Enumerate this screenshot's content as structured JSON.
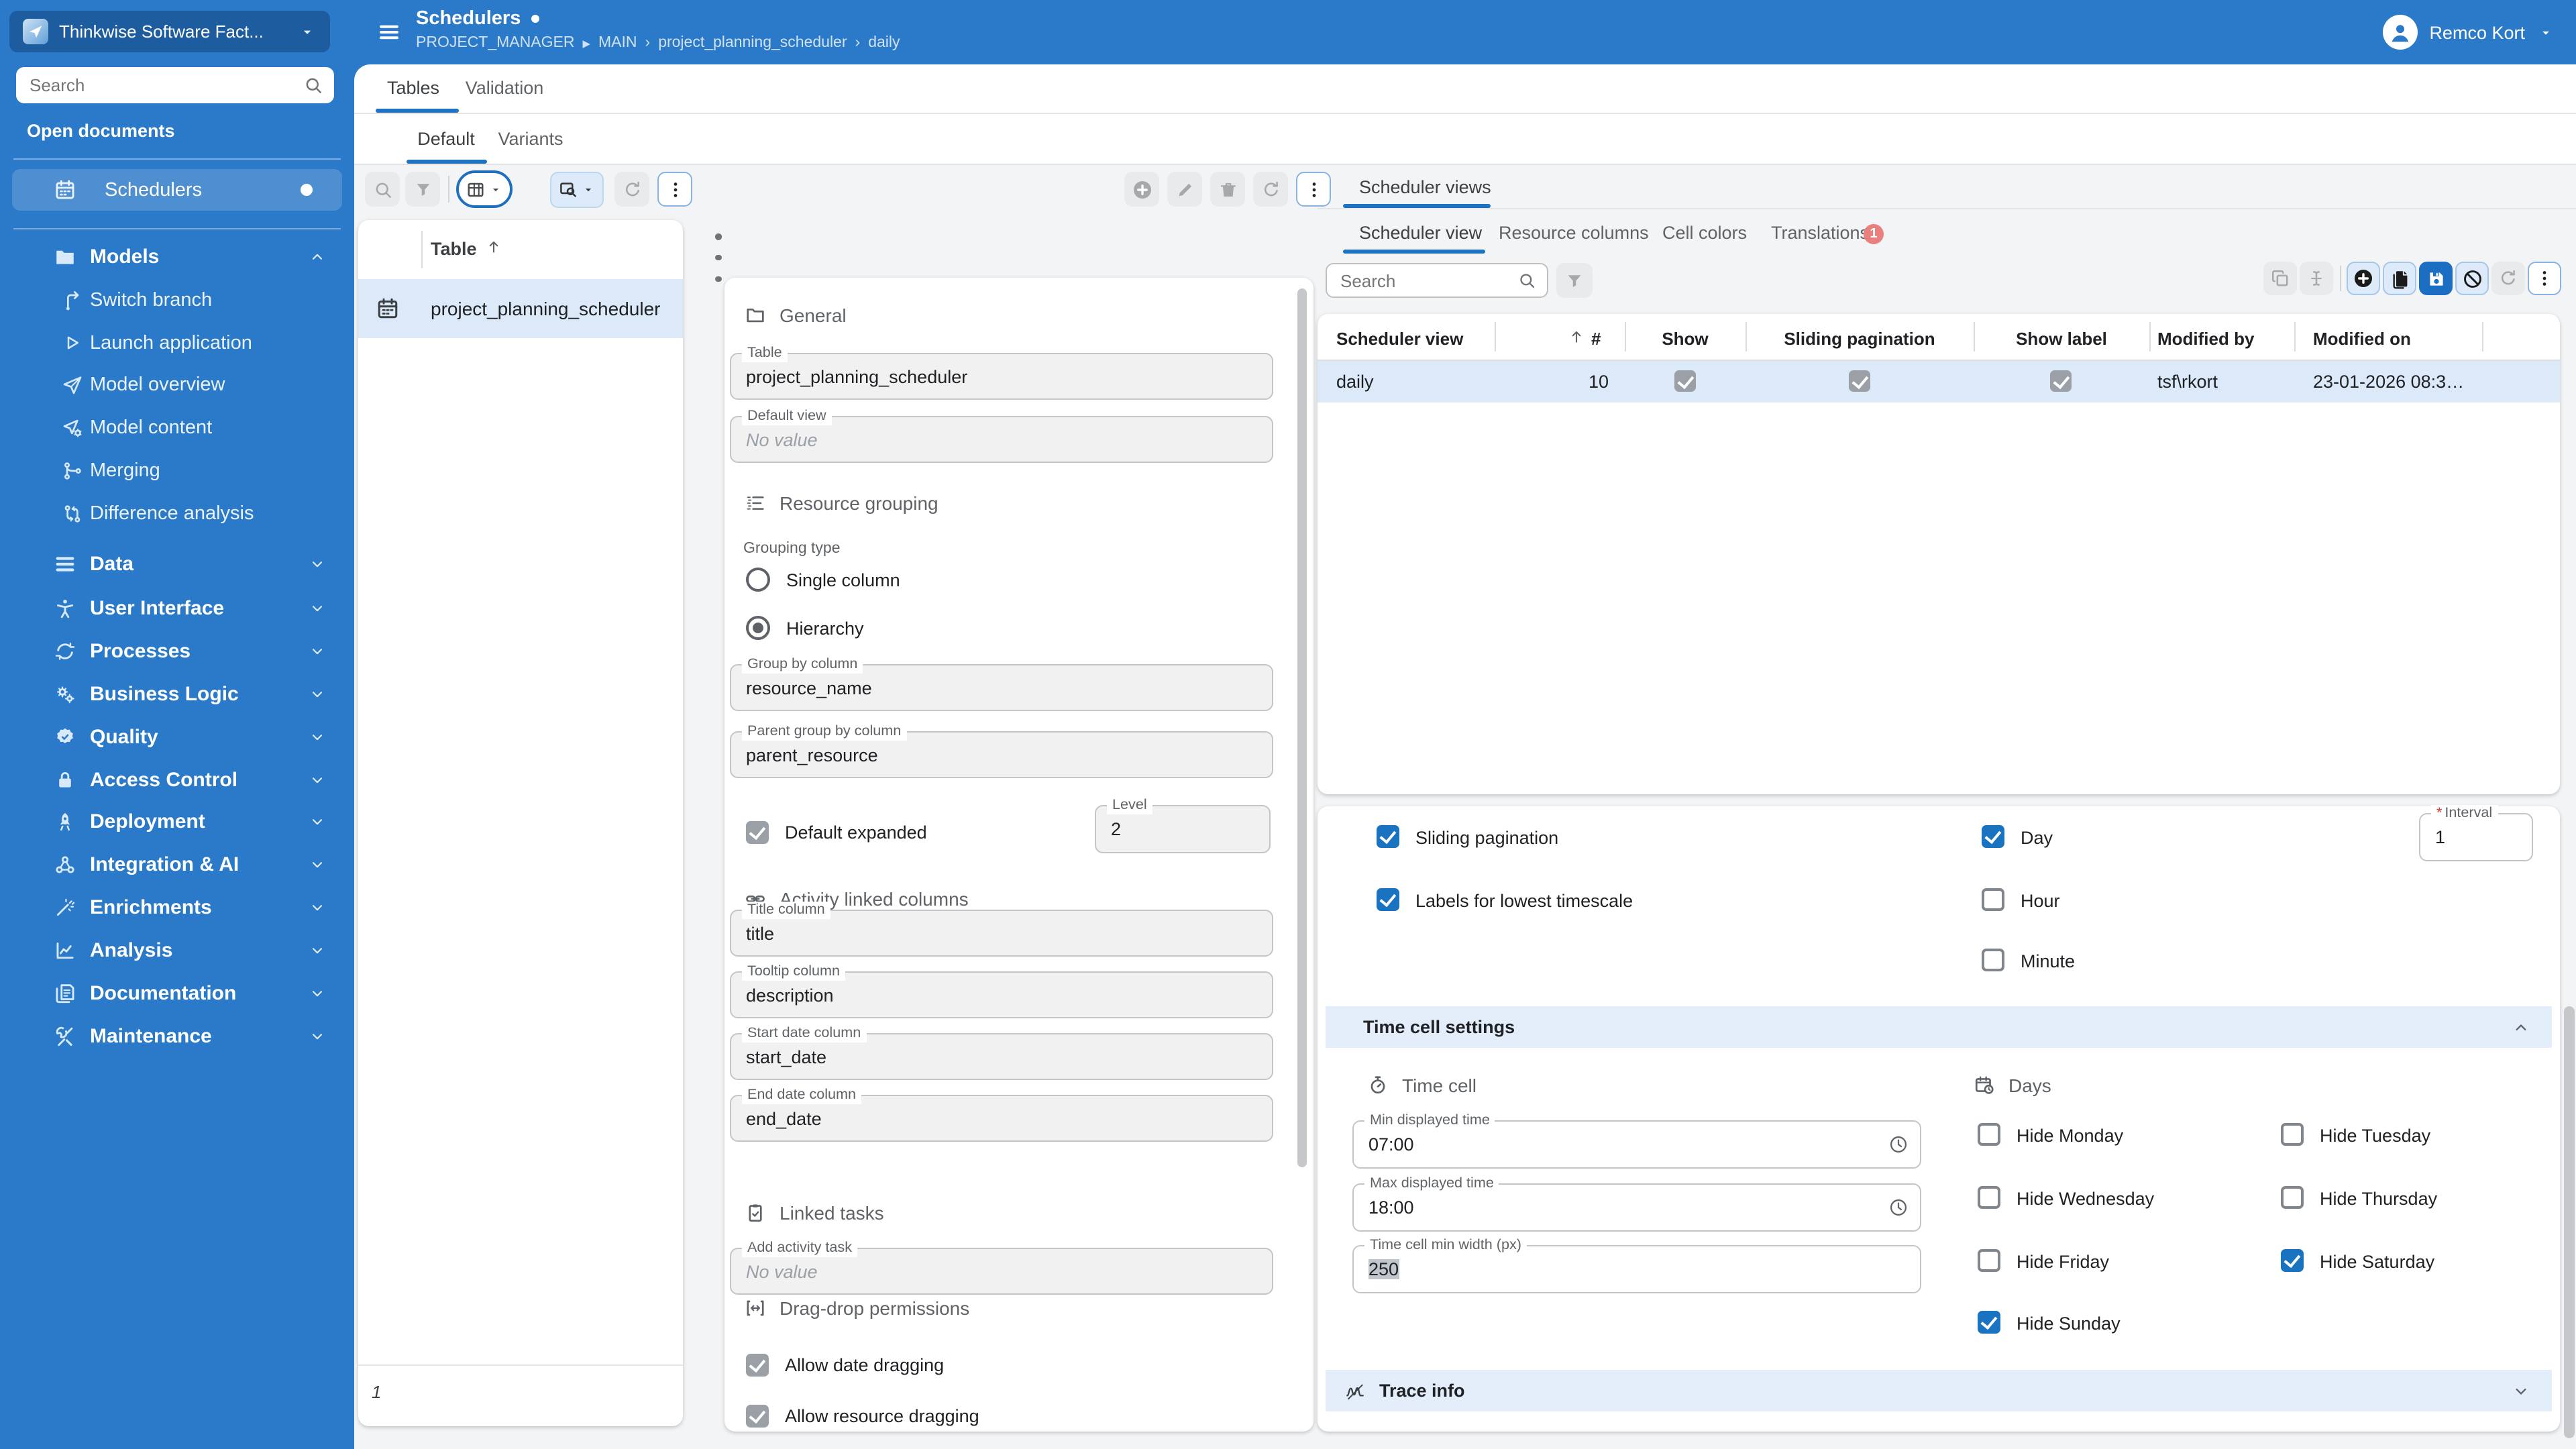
{
  "app": {
    "accent": "#1e72c2",
    "header_blue": "#2b7ac9",
    "selection_blue": "#dbe9f8",
    "badge_red": "#e9807e",
    "save_blue": "#1b6ec2"
  },
  "header": {
    "workspace_selector": "Thinkwise Software Fact...",
    "page_title": "Schedulers",
    "breadcrumb": {
      "items": [
        "PROJECT_MANAGER",
        "MAIN",
        "project_planning_scheduler",
        "daily"
      ],
      "separators": [
        "▸",
        "›",
        "›"
      ]
    },
    "user_name": "Remco Kort"
  },
  "sidebar": {
    "search_placeholder": "Search",
    "section_label": "Open documents",
    "open_documents": [
      {
        "label": "Schedulers"
      }
    ],
    "nav": [
      {
        "label": "Models",
        "expanded": true,
        "children": [
          {
            "label": "Switch branch"
          },
          {
            "label": "Launch application"
          },
          {
            "label": "Model overview"
          },
          {
            "label": "Model content"
          },
          {
            "label": "Merging"
          },
          {
            "label": "Difference analysis"
          }
        ]
      },
      {
        "label": "Data"
      },
      {
        "label": "User Interface"
      },
      {
        "label": "Processes"
      },
      {
        "label": "Business Logic"
      },
      {
        "label": "Quality"
      },
      {
        "label": "Access Control"
      },
      {
        "label": "Deployment"
      },
      {
        "label": "Integration & AI"
      },
      {
        "label": "Enrichments"
      },
      {
        "label": "Analysis"
      },
      {
        "label": "Documentation"
      },
      {
        "label": "Maintenance"
      }
    ]
  },
  "tabs": {
    "level1": [
      "Tables",
      "Validation"
    ],
    "level1_active": "Tables",
    "level2": [
      "Default",
      "Variants"
    ],
    "level2_active": "Default"
  },
  "table_list": {
    "column_header": "Table",
    "rows": [
      {
        "name": "project_planning_scheduler"
      }
    ],
    "selected_row": "project_planning_scheduler",
    "record_count": "1"
  },
  "detail_form": {
    "general": {
      "title": "General",
      "table": {
        "label": "Table",
        "value": "project_planning_scheduler"
      },
      "default_view": {
        "label": "Default view",
        "placeholder": "No value"
      }
    },
    "resource_grouping": {
      "title": "Resource grouping",
      "grouping_type_label": "Grouping type",
      "options": [
        {
          "label": "Single column",
          "selected": false
        },
        {
          "label": "Hierarchy",
          "selected": true
        }
      ],
      "group_by": {
        "label": "Group by column",
        "value": "resource_name"
      },
      "parent_group_by": {
        "label": "Parent group by column",
        "value": "parent_resource"
      },
      "default_expanded": {
        "label": "Default expanded",
        "checked": true
      },
      "level": {
        "label": "Level",
        "value": "2"
      }
    },
    "activity_linked_columns": {
      "title": "Activity linked columns",
      "title_column": {
        "label": "Title column",
        "value": "title"
      },
      "tooltip_column": {
        "label": "Tooltip column",
        "value": "description"
      },
      "start_date_column": {
        "label": "Start date column",
        "value": "start_date"
      },
      "end_date_column": {
        "label": "End date column",
        "value": "end_date"
      }
    },
    "linked_tasks": {
      "title": "Linked tasks",
      "add_activity_task": {
        "label": "Add activity task",
        "placeholder": "No value"
      }
    },
    "drag_drop": {
      "title": "Drag-drop permissions",
      "allow_date_dragging": {
        "label": "Allow date dragging",
        "checked": true
      },
      "allow_resource_dragging": {
        "label": "Allow resource dragging",
        "checked": true
      }
    }
  },
  "scheduler_views": {
    "panel_tab": "Scheduler views",
    "subtabs": [
      "Scheduler view",
      "Resource columns",
      "Cell colors",
      "Translations"
    ],
    "subtab_active": "Scheduler view",
    "translations_badge": "1",
    "search_placeholder": "Search",
    "grid": {
      "columns": [
        "Scheduler view",
        "#",
        "Show",
        "Sliding pagination",
        "Show label",
        "Modified by",
        "Modified on"
      ],
      "rows": [
        {
          "scheduler_view": "daily",
          "seq": "10",
          "show": true,
          "sliding_pagination": true,
          "show_label": true,
          "modified_by": "tsf\\rkort",
          "modified_on": "23-01-2026 08:3…"
        }
      ]
    },
    "form": {
      "sliding_pagination": {
        "label": "Sliding pagination",
        "checked": true
      },
      "labels_lowest": {
        "label": "Labels for lowest timescale",
        "checked": true
      },
      "day": {
        "label": "Day",
        "checked": true
      },
      "hour": {
        "label": "Hour",
        "checked": false
      },
      "minute": {
        "label": "Minute",
        "checked": false
      },
      "interval": {
        "label": "Interval",
        "value": "1",
        "required": true,
        "required_marker": "*"
      },
      "time_cell_settings_title": "Time cell settings",
      "time_cell_group": "Time cell",
      "days_group": "Days",
      "min_displayed_time": {
        "label": "Min displayed time",
        "value": "07:00"
      },
      "max_displayed_time": {
        "label": "Max displayed time",
        "value": "18:00"
      },
      "time_cell_min_width": {
        "label": "Time cell min width (px)",
        "value": "250"
      },
      "hide_days": [
        {
          "label": "Hide Monday",
          "checked": false
        },
        {
          "label": "Hide Tuesday",
          "checked": false
        },
        {
          "label": "Hide Wednesday",
          "checked": false
        },
        {
          "label": "Hide Thursday",
          "checked": false
        },
        {
          "label": "Hide Friday",
          "checked": false
        },
        {
          "label": "Hide Saturday",
          "checked": true
        },
        {
          "label": "Hide Sunday",
          "checked": true
        }
      ],
      "trace_info_title": "Trace info"
    }
  }
}
